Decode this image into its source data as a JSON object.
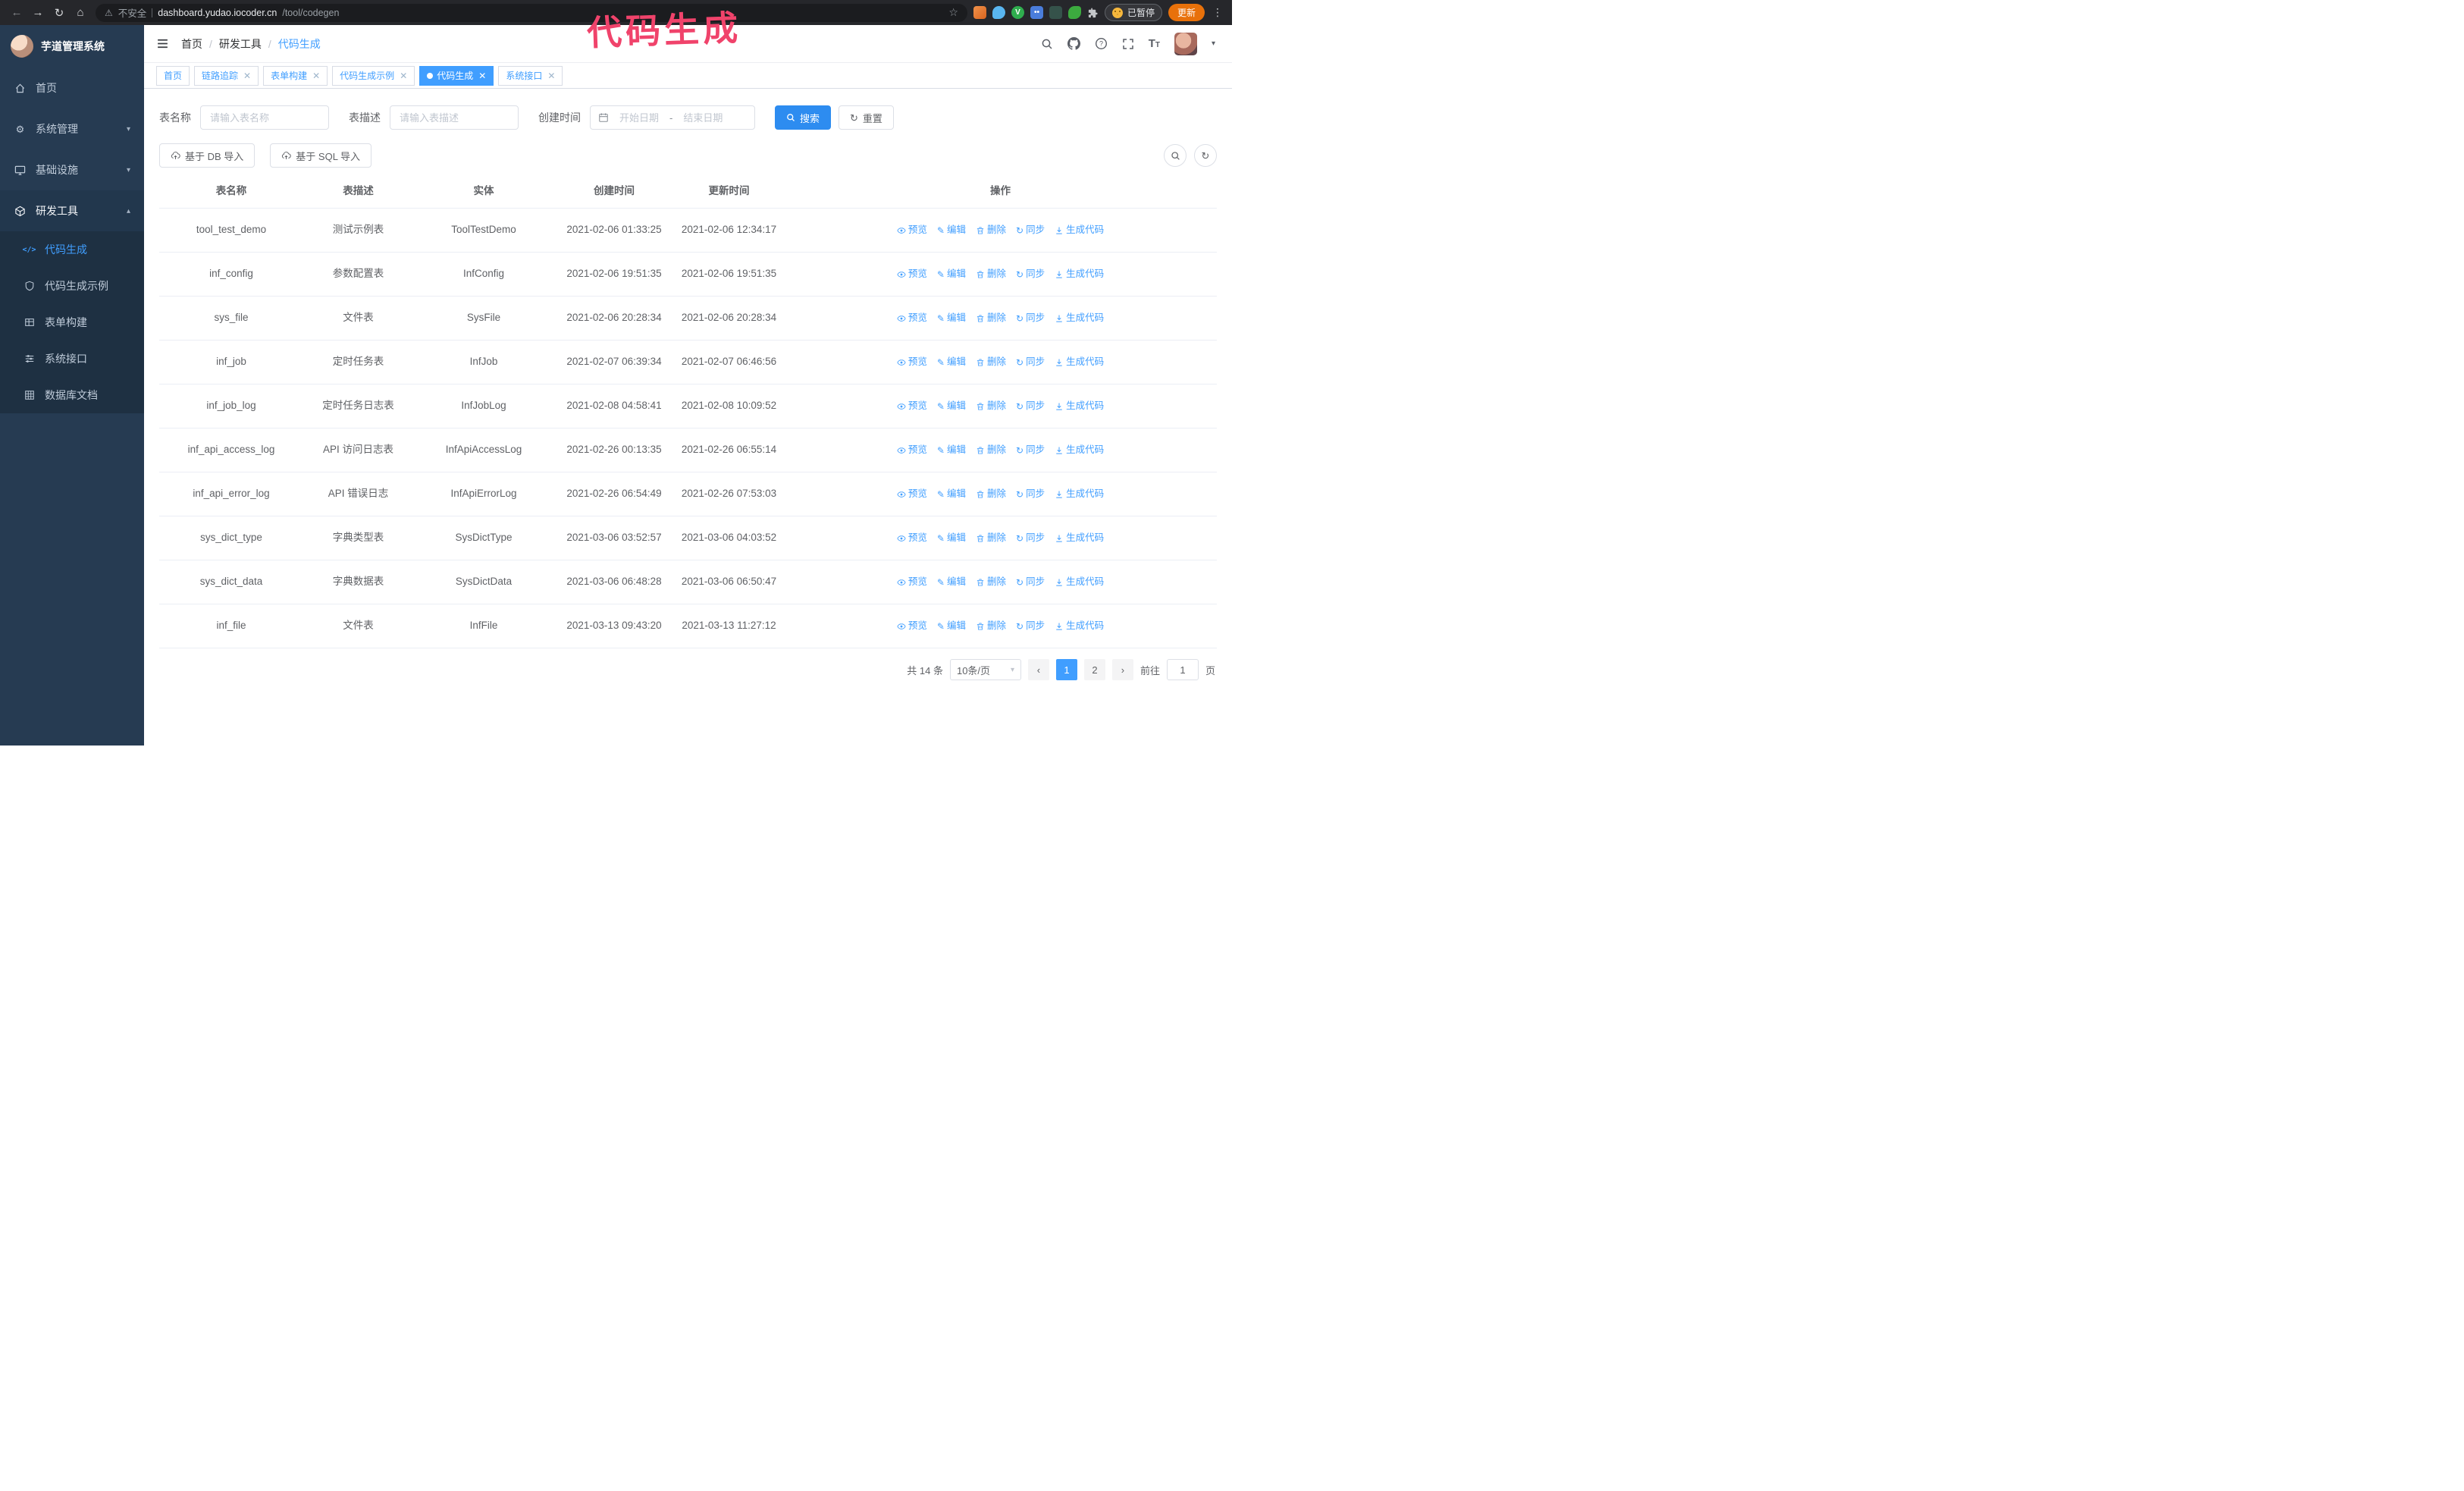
{
  "annotation": {
    "text": "代码生成"
  },
  "browser": {
    "security_label": "不安全",
    "url_domain": "dashboard.yudao.iocoder.cn",
    "url_path": "/tool/codegen",
    "paused_badge": "已暂停",
    "update_button": "更新"
  },
  "sidebar": {
    "title": "芋道管理系统",
    "items": [
      {
        "label": "首页"
      },
      {
        "label": "系统管理"
      },
      {
        "label": "基础设施"
      },
      {
        "label": "研发工具"
      }
    ],
    "subitems": [
      {
        "label": "代码生成"
      },
      {
        "label": "代码生成示例"
      },
      {
        "label": "表单构建"
      },
      {
        "label": "系统接口"
      },
      {
        "label": "数据库文档"
      }
    ]
  },
  "header": {
    "breadcrumb": [
      "首页",
      "研发工具",
      "代码生成"
    ]
  },
  "tabs": [
    {
      "label": "首页",
      "closable": false,
      "active": false
    },
    {
      "label": "链路追踪",
      "closable": true,
      "active": false
    },
    {
      "label": "表单构建",
      "closable": true,
      "active": false
    },
    {
      "label": "代码生成示例",
      "closable": true,
      "active": false
    },
    {
      "label": "代码生成",
      "closable": true,
      "active": true
    },
    {
      "label": "系统接口",
      "closable": true,
      "active": false
    }
  ],
  "filters": {
    "table_name_label": "表名称",
    "table_name_placeholder": "请输入表名称",
    "table_desc_label": "表描述",
    "table_desc_placeholder": "请输入表描述",
    "create_time_label": "创建时间",
    "start_date_placeholder": "开始日期",
    "range_separator": "-",
    "end_date_placeholder": "结束日期",
    "search_button": "搜索",
    "reset_button": "重置"
  },
  "toolbar": {
    "import_db_label": "基于 DB 导入",
    "import_sql_label": "基于 SQL 导入"
  },
  "table": {
    "columns": [
      "表名称",
      "表描述",
      "实体",
      "创建时间",
      "更新时间",
      "操作"
    ],
    "action_labels": [
      "预览",
      "编辑",
      "删除",
      "同步",
      "生成代码"
    ],
    "rows": [
      {
        "name": "tool_test_demo",
        "desc": "测试示例表",
        "entity": "ToolTestDemo",
        "created": "2021-02-06 01:33:25",
        "updated": "2021-02-06 12:34:17"
      },
      {
        "name": "inf_config",
        "desc": "参数配置表",
        "entity": "InfConfig",
        "created": "2021-02-06 19:51:35",
        "updated": "2021-02-06 19:51:35"
      },
      {
        "name": "sys_file",
        "desc": "文件表",
        "entity": "SysFile",
        "created": "2021-02-06 20:28:34",
        "updated": "2021-02-06 20:28:34"
      },
      {
        "name": "inf_job",
        "desc": "定时任务表",
        "entity": "InfJob",
        "created": "2021-02-07 06:39:34",
        "updated": "2021-02-07 06:46:56"
      },
      {
        "name": "inf_job_log",
        "desc": "定时任务日志表",
        "entity": "InfJobLog",
        "created": "2021-02-08 04:58:41",
        "updated": "2021-02-08 10:09:52"
      },
      {
        "name": "inf_api_access_log",
        "desc": "API 访问日志表",
        "entity": "InfApiAccessLog",
        "created": "2021-02-26 00:13:35",
        "updated": "2021-02-26 06:55:14"
      },
      {
        "name": "inf_api_error_log",
        "desc": "API 错误日志",
        "entity": "InfApiErrorLog",
        "created": "2021-02-26 06:54:49",
        "updated": "2021-02-26 07:53:03"
      },
      {
        "name": "sys_dict_type",
        "desc": "字典类型表",
        "entity": "SysDictType",
        "created": "2021-03-06 03:52:57",
        "updated": "2021-03-06 04:03:52"
      },
      {
        "name": "sys_dict_data",
        "desc": "字典数据表",
        "entity": "SysDictData",
        "created": "2021-03-06 06:48:28",
        "updated": "2021-03-06 06:50:47"
      },
      {
        "name": "inf_file",
        "desc": "文件表",
        "entity": "InfFile",
        "created": "2021-03-13 09:43:20",
        "updated": "2021-03-13 11:27:12"
      }
    ]
  },
  "pagination": {
    "total_text": "共 14 条",
    "page_size": "10条/页",
    "pages": [
      "1",
      "2"
    ],
    "active_page": "1",
    "goto_label": "前往",
    "goto_value": "1",
    "unit_label": "页"
  }
}
